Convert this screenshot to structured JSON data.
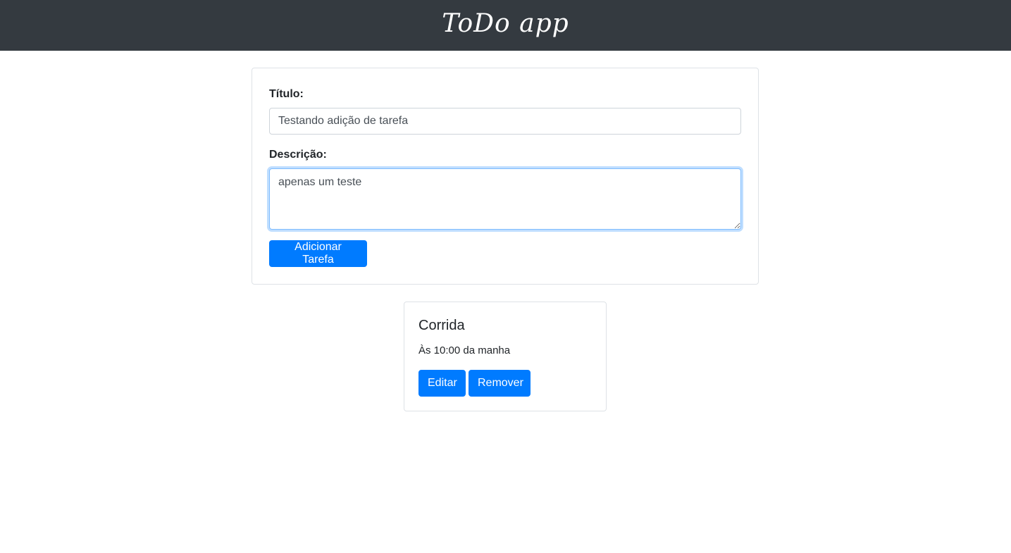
{
  "header": {
    "brand": "ToDo app"
  },
  "form": {
    "title_label": "Título:",
    "title_value": "Testando adição de tarefa",
    "description_label": "Descrição:",
    "description_value": "apenas um teste",
    "submit_label": "Adicionar Tarefa"
  },
  "tasks": [
    {
      "title": "Corrida",
      "description": "Às 10:00 da manha",
      "edit_label": "Editar",
      "remove_label": "Remover"
    }
  ],
  "colors": {
    "navbar": "#343a40",
    "primary": "#007bff",
    "border": "#dee2e6"
  }
}
